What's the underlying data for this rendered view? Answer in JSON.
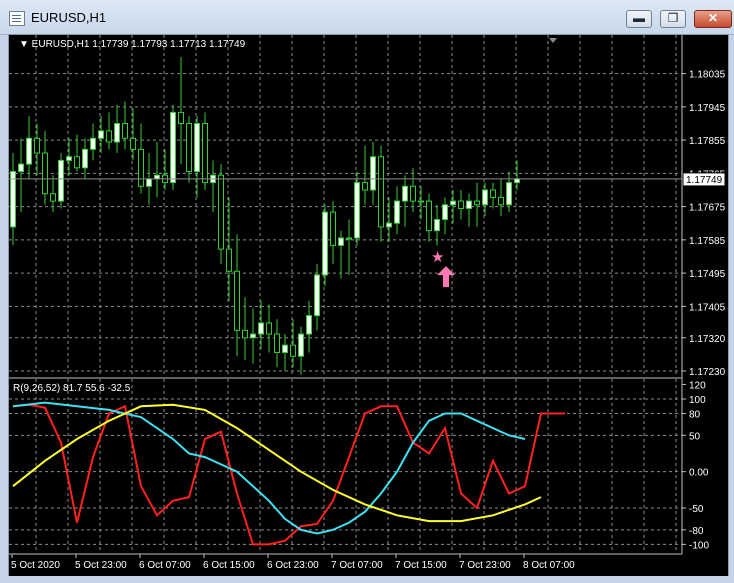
{
  "window": {
    "title": "EURUSD,H1",
    "minimize_label": "▬",
    "maximize_label": "❐",
    "close_label": "✕"
  },
  "main_chart": {
    "header": "▼ EURUSD,H1  1.17739 1.17793 1.17713 1.17749",
    "current_price_label": "1.17749",
    "price_ticks": [
      "1.18035",
      "1.17945",
      "1.17855",
      "1.17765",
      "1.17675",
      "1.17585",
      "1.17495",
      "1.17405",
      "1.17320",
      "1.17230"
    ]
  },
  "indicator": {
    "header": "R(9,26,52) 81.7 55.6 -32.5",
    "ticks": [
      "120",
      "100",
      "80",
      "50",
      "0.00",
      "-50",
      "-80",
      "-100"
    ]
  },
  "time_axis": [
    "5 Oct 2020",
    "5 Oct 23:00",
    "6 Oct 07:00",
    "6 Oct 15:00",
    "6 Oct 23:00",
    "7 Oct 07:00",
    "7 Oct 15:00",
    "7 Oct 23:00",
    "8 Oct 07:00"
  ],
  "colors": {
    "background": "#000000",
    "grid": "#8c8c8c",
    "bull_candle": "#ffffff",
    "bear_candle": "#000000",
    "wick": "#32cd32",
    "line_fast": "#ff2020",
    "line_mid": "#40e0f0",
    "line_slow": "#ffff30",
    "signal_marker": "#ff78b4"
  },
  "chart_data": [
    {
      "type": "candlestick",
      "title": "EURUSD,H1",
      "ylim": [
        1.1723,
        1.1808
      ],
      "x_unit": "hours from 5 Oct 2020 15:00",
      "candles": [
        {
          "t": 0,
          "o": 1.1762,
          "h": 1.1782,
          "l": 1.1757,
          "c": 1.1777
        },
        {
          "t": 1,
          "o": 1.1777,
          "h": 1.1786,
          "l": 1.1766,
          "c": 1.1779
        },
        {
          "t": 2,
          "o": 1.1779,
          "h": 1.1792,
          "l": 1.1775,
          "c": 1.1786
        },
        {
          "t": 3,
          "o": 1.1786,
          "h": 1.179,
          "l": 1.1776,
          "c": 1.1782
        },
        {
          "t": 4,
          "o": 1.1782,
          "h": 1.1788,
          "l": 1.1768,
          "c": 1.1771
        },
        {
          "t": 5,
          "o": 1.1771,
          "h": 1.1776,
          "l": 1.1766,
          "c": 1.1769
        },
        {
          "t": 6,
          "o": 1.1769,
          "h": 1.1782,
          "l": 1.1767,
          "c": 1.178
        },
        {
          "t": 7,
          "o": 1.178,
          "h": 1.1786,
          "l": 1.1776,
          "c": 1.1781
        },
        {
          "t": 8,
          "o": 1.1781,
          "h": 1.1787,
          "l": 1.1777,
          "c": 1.1778
        },
        {
          "t": 9,
          "o": 1.1778,
          "h": 1.1786,
          "l": 1.1775,
          "c": 1.1783
        },
        {
          "t": 10,
          "o": 1.1783,
          "h": 1.179,
          "l": 1.178,
          "c": 1.1786
        },
        {
          "t": 11,
          "o": 1.1786,
          "h": 1.1792,
          "l": 1.1782,
          "c": 1.1788
        },
        {
          "t": 12,
          "o": 1.1788,
          "h": 1.1793,
          "l": 1.1783,
          "c": 1.1785
        },
        {
          "t": 13,
          "o": 1.1785,
          "h": 1.1795,
          "l": 1.1782,
          "c": 1.179
        },
        {
          "t": 14,
          "o": 1.179,
          "h": 1.1796,
          "l": 1.1783,
          "c": 1.1786
        },
        {
          "t": 15,
          "o": 1.1786,
          "h": 1.1794,
          "l": 1.178,
          "c": 1.1783
        },
        {
          "t": 16,
          "o": 1.1783,
          "h": 1.179,
          "l": 1.1771,
          "c": 1.1773
        },
        {
          "t": 17,
          "o": 1.1773,
          "h": 1.1782,
          "l": 1.1768,
          "c": 1.1775
        },
        {
          "t": 18,
          "o": 1.1775,
          "h": 1.1785,
          "l": 1.177,
          "c": 1.1776
        },
        {
          "t": 19,
          "o": 1.1776,
          "h": 1.1783,
          "l": 1.1772,
          "c": 1.1774
        },
        {
          "t": 20,
          "o": 1.1774,
          "h": 1.1795,
          "l": 1.1772,
          "c": 1.1793
        },
        {
          "t": 21,
          "o": 1.1793,
          "h": 1.1808,
          "l": 1.1779,
          "c": 1.179
        },
        {
          "t": 22,
          "o": 1.179,
          "h": 1.1792,
          "l": 1.1774,
          "c": 1.1777
        },
        {
          "t": 23,
          "o": 1.1777,
          "h": 1.1792,
          "l": 1.177,
          "c": 1.179
        },
        {
          "t": 24,
          "o": 1.179,
          "h": 1.1793,
          "l": 1.1772,
          "c": 1.1774
        },
        {
          "t": 25,
          "o": 1.1774,
          "h": 1.178,
          "l": 1.1766,
          "c": 1.1776
        },
        {
          "t": 26,
          "o": 1.1776,
          "h": 1.1779,
          "l": 1.1752,
          "c": 1.1756
        },
        {
          "t": 27,
          "o": 1.1756,
          "h": 1.177,
          "l": 1.1742,
          "c": 1.175
        },
        {
          "t": 28,
          "o": 1.175,
          "h": 1.176,
          "l": 1.1727,
          "c": 1.1734
        },
        {
          "t": 29,
          "o": 1.1734,
          "h": 1.1743,
          "l": 1.1726,
          "c": 1.1732
        },
        {
          "t": 30,
          "o": 1.1732,
          "h": 1.174,
          "l": 1.1725,
          "c": 1.1733
        },
        {
          "t": 31,
          "o": 1.1733,
          "h": 1.1742,
          "l": 1.1729,
          "c": 1.1736
        },
        {
          "t": 32,
          "o": 1.1736,
          "h": 1.1741,
          "l": 1.1728,
          "c": 1.1733
        },
        {
          "t": 33,
          "o": 1.1733,
          "h": 1.1737,
          "l": 1.1724,
          "c": 1.1728
        },
        {
          "t": 34,
          "o": 1.1728,
          "h": 1.1733,
          "l": 1.1723,
          "c": 1.173
        },
        {
          "t": 35,
          "o": 1.173,
          "h": 1.1737,
          "l": 1.1724,
          "c": 1.1727
        },
        {
          "t": 36,
          "o": 1.1727,
          "h": 1.1735,
          "l": 1.1722,
          "c": 1.1733
        },
        {
          "t": 37,
          "o": 1.1733,
          "h": 1.1742,
          "l": 1.1728,
          "c": 1.1738
        },
        {
          "t": 38,
          "o": 1.1738,
          "h": 1.1752,
          "l": 1.1734,
          "c": 1.1749
        },
        {
          "t": 39,
          "o": 1.1749,
          "h": 1.1768,
          "l": 1.1746,
          "c": 1.1766
        },
        {
          "t": 40,
          "o": 1.1766,
          "h": 1.1769,
          "l": 1.1752,
          "c": 1.1757
        },
        {
          "t": 41,
          "o": 1.1757,
          "h": 1.1761,
          "l": 1.1748,
          "c": 1.1759
        },
        {
          "t": 42,
          "o": 1.1759,
          "h": 1.1764,
          "l": 1.1749,
          "c": 1.1759
        },
        {
          "t": 43,
          "o": 1.1759,
          "h": 1.1777,
          "l": 1.1757,
          "c": 1.1774
        },
        {
          "t": 44,
          "o": 1.1774,
          "h": 1.1784,
          "l": 1.1768,
          "c": 1.1772
        },
        {
          "t": 45,
          "o": 1.1772,
          "h": 1.1785,
          "l": 1.1768,
          "c": 1.1781
        },
        {
          "t": 46,
          "o": 1.1781,
          "h": 1.1784,
          "l": 1.1758,
          "c": 1.1762
        },
        {
          "t": 47,
          "o": 1.1762,
          "h": 1.177,
          "l": 1.1758,
          "c": 1.1763
        },
        {
          "t": 48,
          "o": 1.1763,
          "h": 1.1773,
          "l": 1.176,
          "c": 1.1769
        },
        {
          "t": 49,
          "o": 1.1769,
          "h": 1.1776,
          "l": 1.1762,
          "c": 1.1773
        },
        {
          "t": 50,
          "o": 1.1773,
          "h": 1.1778,
          "l": 1.1766,
          "c": 1.1769
        },
        {
          "t": 51,
          "o": 1.1769,
          "h": 1.1773,
          "l": 1.1764,
          "c": 1.1769
        },
        {
          "t": 52,
          "o": 1.1769,
          "h": 1.1771,
          "l": 1.1758,
          "c": 1.1761
        },
        {
          "t": 53,
          "o": 1.1761,
          "h": 1.1768,
          "l": 1.1757,
          "c": 1.1764
        },
        {
          "t": 54,
          "o": 1.1764,
          "h": 1.177,
          "l": 1.176,
          "c": 1.1768
        },
        {
          "t": 55,
          "o": 1.1768,
          "h": 1.1772,
          "l": 1.1763,
          "c": 1.1769
        },
        {
          "t": 56,
          "o": 1.1769,
          "h": 1.1772,
          "l": 1.1764,
          "c": 1.1767
        },
        {
          "t": 57,
          "o": 1.1767,
          "h": 1.1771,
          "l": 1.1762,
          "c": 1.1769
        },
        {
          "t": 58,
          "o": 1.1769,
          "h": 1.1774,
          "l": 1.1762,
          "c": 1.1768
        },
        {
          "t": 59,
          "o": 1.1768,
          "h": 1.1774,
          "l": 1.1765,
          "c": 1.1772
        },
        {
          "t": 60,
          "o": 1.1772,
          "h": 1.1774,
          "l": 1.1767,
          "c": 1.177
        },
        {
          "t": 61,
          "o": 1.177,
          "h": 1.1775,
          "l": 1.1765,
          "c": 1.1768
        },
        {
          "t": 62,
          "o": 1.1768,
          "h": 1.1777,
          "l": 1.1766,
          "c": 1.1774
        },
        {
          "t": 63,
          "o": 1.1774,
          "h": 1.178,
          "l": 1.1772,
          "c": 1.1775
        }
      ],
      "signal": {
        "candle": 53,
        "price": 1.1753
      }
    },
    {
      "type": "line",
      "title": "R(9,26,52)",
      "ylim": [
        -105,
        122
      ],
      "series": [
        {
          "points": [
            [
              0,
              90
            ],
            [
              2,
              92
            ],
            [
              4,
              88
            ],
            [
              6,
              40
            ],
            [
              8,
              -70
            ],
            [
              10,
              20
            ],
            [
              12,
              80
            ],
            [
              14,
              90
            ],
            [
              16,
              -20
            ],
            [
              18,
              -60
            ],
            [
              20,
              -40
            ],
            [
              22,
              -35
            ],
            [
              24,
              45
            ],
            [
              26,
              55
            ],
            [
              28,
              -30
            ],
            [
              30,
              -100
            ],
            [
              32,
              -100
            ],
            [
              34,
              -95
            ],
            [
              36,
              -75
            ],
            [
              38,
              -72
            ],
            [
              40,
              -40
            ],
            [
              42,
              20
            ],
            [
              44,
              80
            ],
            [
              46,
              90
            ],
            [
              48,
              90
            ],
            [
              50,
              40
            ],
            [
              52,
              25
            ],
            [
              54,
              60
            ],
            [
              56,
              -30
            ],
            [
              58,
              -50
            ],
            [
              60,
              15
            ],
            [
              62,
              -30
            ],
            [
              64,
              -20
            ],
            [
              66,
              80
            ],
            [
              68,
              80
            ],
            [
              69,
              80
            ]
          ]
        },
        {
          "points": [
            [
              0,
              90
            ],
            [
              4,
              95
            ],
            [
              8,
              90
            ],
            [
              12,
              85
            ],
            [
              16,
              75
            ],
            [
              18,
              60
            ],
            [
              20,
              45
            ],
            [
              22,
              25
            ],
            [
              24,
              20
            ],
            [
              26,
              10
            ],
            [
              28,
              0
            ],
            [
              30,
              -20
            ],
            [
              32,
              -40
            ],
            [
              34,
              -65
            ],
            [
              36,
              -80
            ],
            [
              38,
              -85
            ],
            [
              40,
              -80
            ],
            [
              42,
              -70
            ],
            [
              44,
              -55
            ],
            [
              46,
              -30
            ],
            [
              48,
              0
            ],
            [
              50,
              40
            ],
            [
              52,
              70
            ],
            [
              54,
              80
            ],
            [
              56,
              80
            ],
            [
              58,
              70
            ],
            [
              60,
              60
            ],
            [
              62,
              50
            ],
            [
              64,
              45
            ]
          ]
        },
        {
          "points": [
            [
              0,
              -20
            ],
            [
              4,
              15
            ],
            [
              8,
              45
            ],
            [
              12,
              70
            ],
            [
              16,
              90
            ],
            [
              20,
              92
            ],
            [
              24,
              85
            ],
            [
              28,
              60
            ],
            [
              32,
              30
            ],
            [
              36,
              0
            ],
            [
              40,
              -25
            ],
            [
              44,
              -45
            ],
            [
              48,
              -60
            ],
            [
              52,
              -68
            ],
            [
              56,
              -68
            ],
            [
              60,
              -60
            ],
            [
              64,
              -45
            ],
            [
              66,
              -35
            ]
          ]
        }
      ]
    }
  ]
}
